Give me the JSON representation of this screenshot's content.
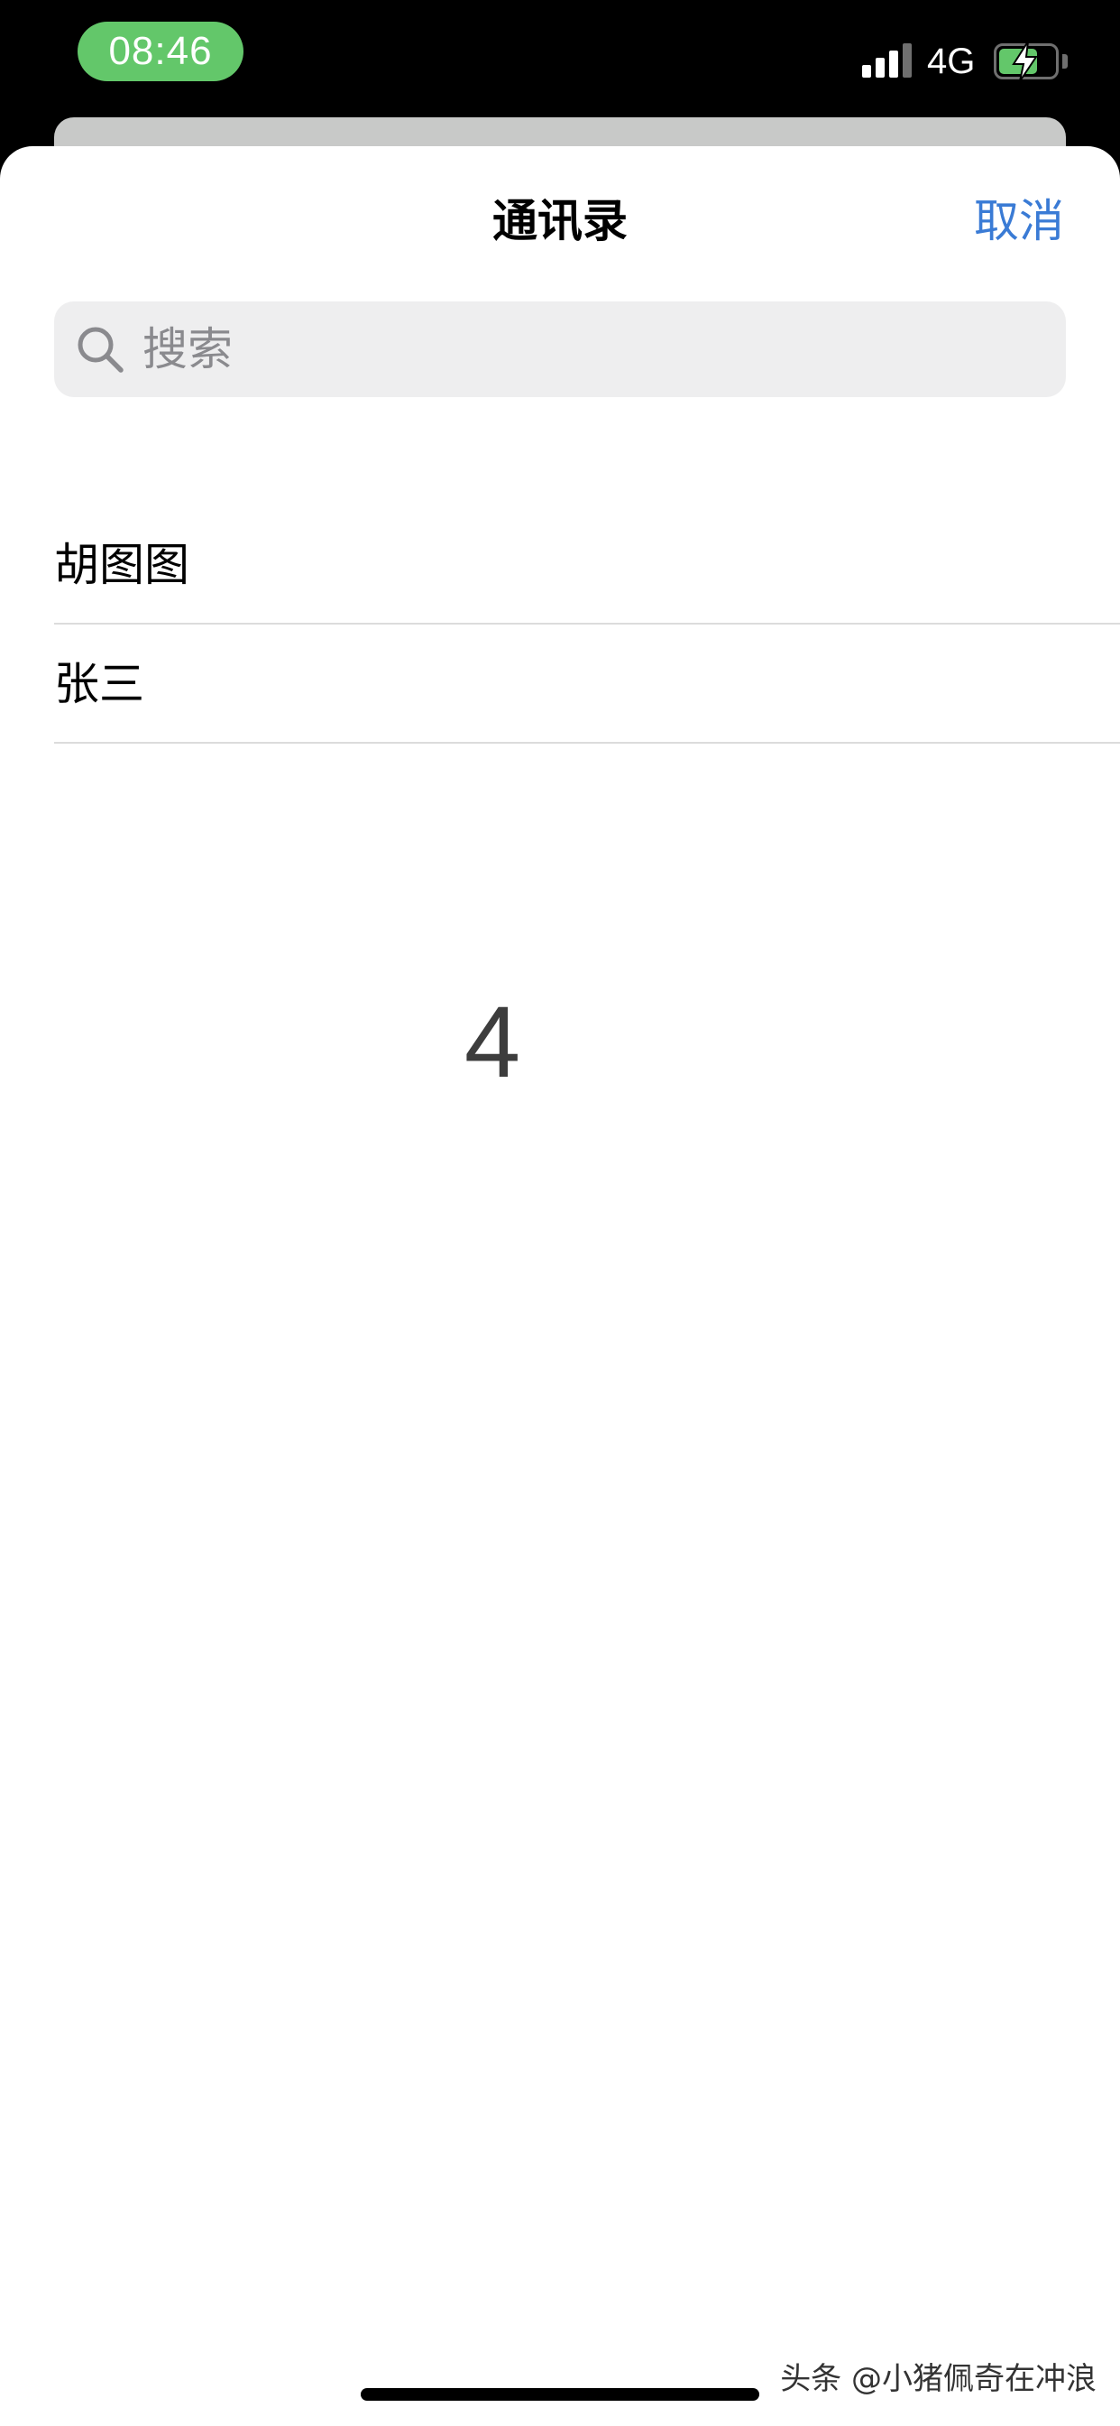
{
  "status_bar": {
    "time": "08:46",
    "network": "4G",
    "colors": {
      "time_pill": "#63c76a",
      "battery_fill": "#63c76a"
    },
    "icons": [
      "signal-icon",
      "battery-charging-icon"
    ]
  },
  "sheet": {
    "title": "通讯录",
    "cancel_label": "取消"
  },
  "search": {
    "placeholder": "搜索",
    "value": ""
  },
  "contacts": [
    {
      "name": "胡图图"
    },
    {
      "name": "张三"
    }
  ],
  "overlay_number": "4",
  "watermark": "头条 @小猪佩奇在冲浪",
  "colors": {
    "accent": "#3a7bd5",
    "search_bg": "#eeeeef",
    "divider": "#dcdcdc"
  }
}
